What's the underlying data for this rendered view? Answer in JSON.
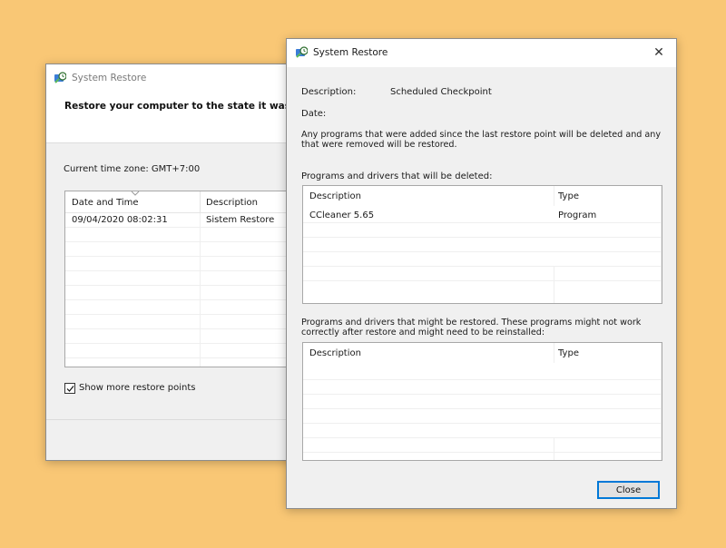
{
  "back_window": {
    "title": "System Restore",
    "heading": "Restore your computer to the state it was in b",
    "timezone": "Current time zone: GMT+7:00",
    "columns": [
      "Date and Time",
      "Description"
    ],
    "rows": [
      {
        "date": "09/04/2020 08:02:31",
        "description": "Sistem Restore"
      }
    ],
    "show_more_label": "Show more restore points",
    "show_more_checked": true
  },
  "front_window": {
    "title": "System Restore",
    "close_glyph": "✕",
    "description_label": "Description:",
    "description_value": "Scheduled Checkpoint",
    "date_label": "Date:",
    "warning_text": "Any programs that were added since the last restore point will be deleted and any that were removed will be restored.",
    "deleted_label": "Programs and drivers that will be deleted:",
    "deleted_columns": [
      "Description",
      "Type"
    ],
    "deleted_rows": [
      {
        "description": "CCleaner 5.65",
        "type": "Program"
      }
    ],
    "restored_label": "Programs and drivers that might be restored. These programs might not work correctly after restore and might need to be reinstalled:",
    "restored_columns": [
      "Description",
      "Type"
    ],
    "restored_rows": [],
    "close_button_label": "Close"
  },
  "colors": {
    "background": "#f9c775",
    "accent": "#0078d7"
  },
  "icons": {
    "window_icon": "system-restore-icon",
    "checkbox": "checkmark-icon",
    "sort": "sort-chevron-icon"
  }
}
